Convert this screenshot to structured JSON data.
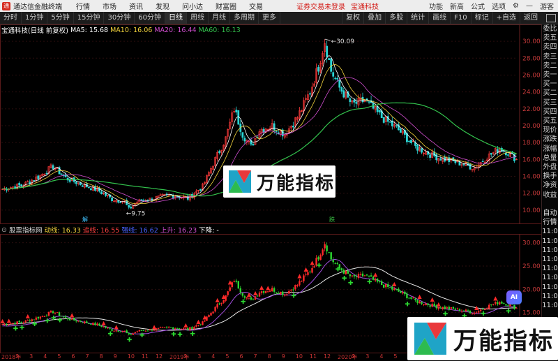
{
  "menubar": {
    "app_title": "通达信金融终端",
    "items": [
      "行情",
      "市场",
      "资讯",
      "发现",
      "问小达",
      "财富圈",
      "交易"
    ],
    "warning": "证券交易未登录",
    "stock_name": "宝通科技",
    "right": [
      "功能",
      "新高",
      "公式",
      "选项",
      "游客"
    ]
  },
  "toolbar": {
    "periods": [
      "分时",
      "1分钟",
      "5分钟",
      "15分钟",
      "30分钟",
      "60分钟",
      "日线",
      "周线",
      "月线",
      "多周期",
      "更多"
    ],
    "active_period": "日线",
    "right": [
      "复权",
      "叠加",
      "多股",
      "统计",
      "画线",
      "F10",
      "标记",
      "+自选",
      "返回"
    ]
  },
  "legend": {
    "title": "宝通科技(日线 前复权)",
    "ma": [
      {
        "label": "MA5: 15.68",
        "color": "#ffffff"
      },
      {
        "label": "MA10: 16.06",
        "color": "#f2d33c"
      },
      {
        "label": "MA20: 16.44",
        "color": "#d24fd1"
      },
      {
        "label": "MA60: 16.13",
        "color": "#33c24d"
      }
    ]
  },
  "sub_legend": {
    "title": "股票指标网",
    "items": [
      {
        "label": "动线: 16.33",
        "color": "#f2d33c"
      },
      {
        "label": "追线: 16.55",
        "color": "#ff4040"
      },
      {
        "label": "强线: 16.62",
        "color": "#4a62ff"
      },
      {
        "label": "上升: 16.23",
        "color": "#d24fd1"
      },
      {
        "label": "下降: -",
        "color": "#ffffff"
      }
    ]
  },
  "main_axis": [
    "30.00",
    "28.00",
    "26.00",
    "24.00",
    "22.00",
    "20.00",
    "18.00",
    "16.00",
    "14.00",
    "12.00",
    "10.00"
  ],
  "sub_axis": [
    "30.00",
    "25.00",
    "20.00",
    "15.00",
    "10.00"
  ],
  "annotations": {
    "high": "30.09",
    "low": "9.75",
    "marker1": "解",
    "marker2": "跌"
  },
  "right_panel": [
    "委比",
    "卖五",
    "卖四",
    "卖三",
    "卖二",
    "卖一",
    "买一",
    "买二",
    "买三",
    "买四",
    "买五",
    "现价",
    "涨跌",
    "涨幅",
    "总量",
    "外盘",
    "换手",
    "净资",
    "收益",
    "",
    "自动",
    "行情",
    "11:0",
    "11:0",
    "11:0",
    "11:0",
    "11:0",
    "11:0",
    "11:0",
    "11:0",
    "11:0"
  ],
  "banners": {
    "top": "万能指标",
    "bottom": "万能指标"
  },
  "ai_badge": "AI",
  "xaxis": [
    "2018年",
    "2",
    "3",
    "4",
    "5",
    "6",
    "7",
    "8",
    "9",
    "10",
    "11",
    "12",
    "2019年",
    "2",
    "3",
    "4",
    "5",
    "6",
    "7",
    "8",
    "9",
    "10",
    "11",
    "12",
    "2020年",
    "2",
    "3",
    "4",
    "5",
    "6",
    "7",
    "8",
    "9",
    "10",
    "11",
    "12"
  ],
  "chart_data": {
    "type": "candlestick",
    "ylim": [
      9,
      31
    ],
    "anchors": [
      [
        0,
        12.5
      ],
      [
        10,
        13.0
      ],
      [
        18,
        14.1
      ],
      [
        24,
        15.2
      ],
      [
        30,
        13.8
      ],
      [
        38,
        13.0
      ],
      [
        45,
        12.4
      ],
      [
        52,
        11.3
      ],
      [
        58,
        11.0
      ],
      [
        60,
        10.1
      ],
      [
        64,
        11.0
      ],
      [
        72,
        11.4
      ],
      [
        80,
        11.8
      ],
      [
        88,
        11.4
      ],
      [
        95,
        12.8
      ],
      [
        100,
        15.5
      ],
      [
        106,
        18.5
      ],
      [
        110,
        22.0
      ],
      [
        114,
        19.0
      ],
      [
        118,
        17.5
      ],
      [
        122,
        19.5
      ],
      [
        128,
        20.0
      ],
      [
        134,
        19.0
      ],
      [
        140,
        21.0
      ],
      [
        146,
        24.0
      ],
      [
        150,
        27.0
      ],
      [
        153,
        30.0
      ],
      [
        156,
        26.5
      ],
      [
        160,
        24.5
      ],
      [
        166,
        22.5
      ],
      [
        172,
        23.0
      ],
      [
        180,
        21.0
      ],
      [
        188,
        19.5
      ],
      [
        196,
        17.5
      ],
      [
        204,
        16.5
      ],
      [
        210,
        16.0
      ],
      [
        218,
        15.5
      ],
      [
        224,
        15.0
      ],
      [
        230,
        16.3
      ],
      [
        236,
        17.3
      ],
      [
        240,
        16.8
      ],
      [
        244,
        16.0
      ]
    ]
  }
}
